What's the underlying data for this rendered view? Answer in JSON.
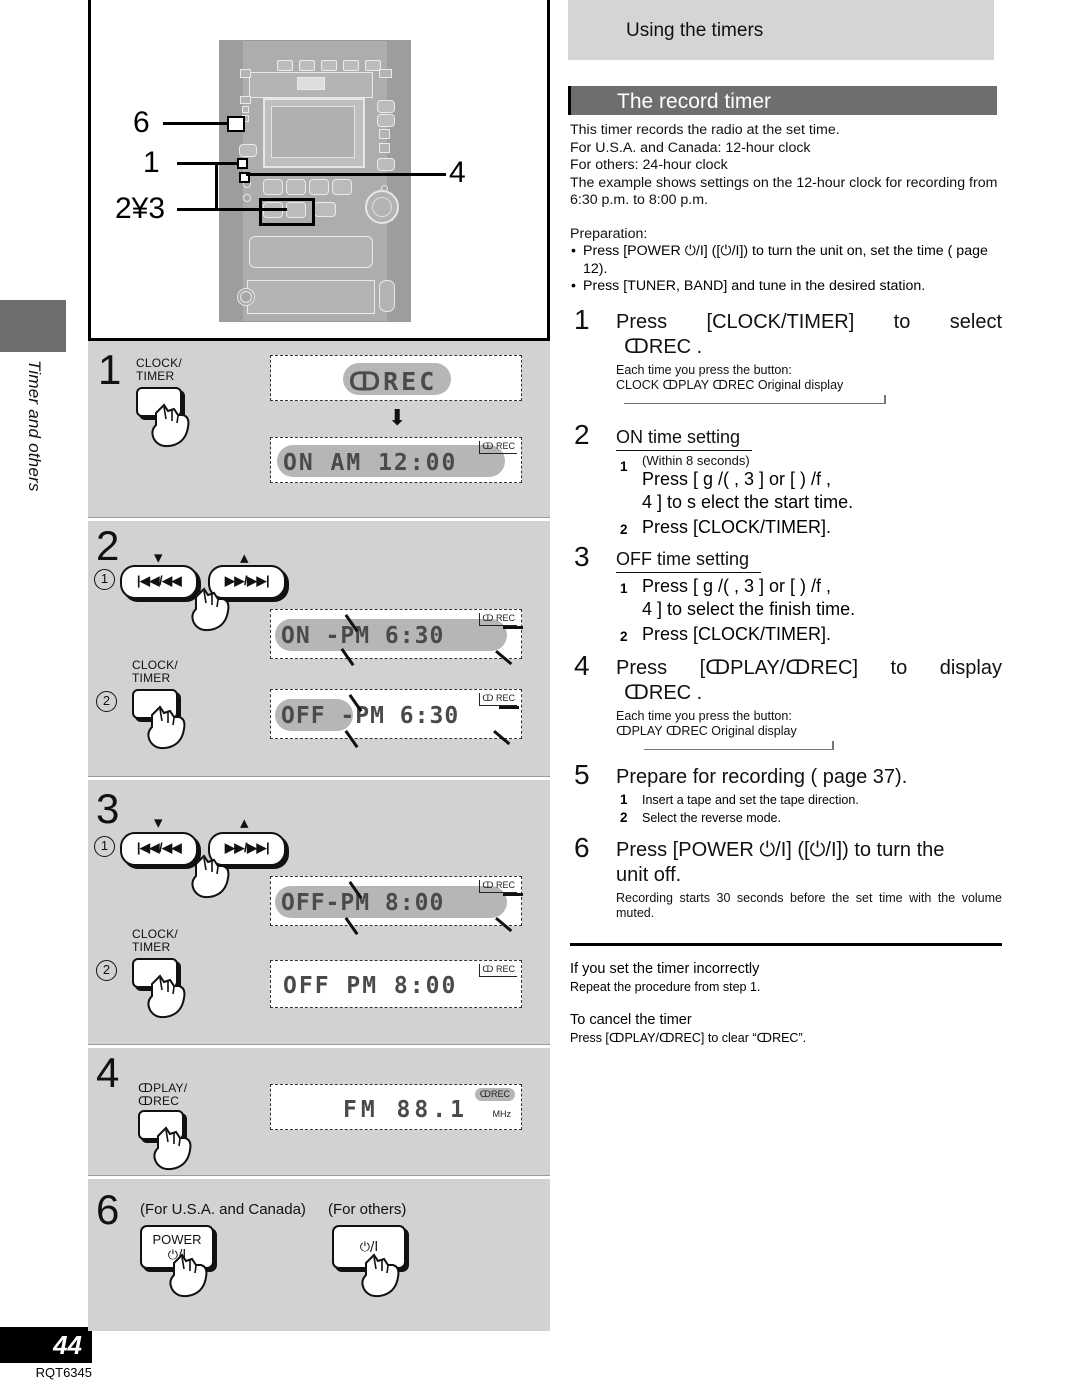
{
  "margin": {
    "vertical_label": "Timer and others",
    "page_number": "44",
    "doc_code": "RQT6345"
  },
  "illustration": {
    "callouts": [
      "6",
      "1",
      "2¥3",
      "4"
    ]
  },
  "left_steps": [
    {
      "num": "1",
      "button_label": "CLOCK/\nTIMER",
      "button_label_line1": "CLOCK/",
      "button_label_line2": "TIMER",
      "displays": [
        {
          "text": "ↀREC",
          "indicator": "",
          "highlight": true
        },
        {
          "text": "ON   AM 12:00",
          "indicator": "ↀ REC",
          "highlight": true
        }
      ]
    },
    {
      "num": "2",
      "sub1": "1",
      "sub2": "2",
      "btn_left": "|◀◀/◀◀",
      "btn_right": "▶▶/▶▶|",
      "button_label_line1": "CLOCK/",
      "button_label_line2": "TIMER",
      "displays": [
        {
          "text": "ON  -PM  6:30",
          "indicator": "ↀ REC",
          "highlight": true
        },
        {
          "text": "OFF -PM  6:30",
          "indicator": "ↀ REC",
          "highlight": "partial"
        }
      ]
    },
    {
      "num": "3",
      "sub1": "1",
      "sub2": "2",
      "btn_left": "|◀◀/◀◀",
      "btn_right": "▶▶/▶▶|",
      "button_label_line1": "CLOCK/",
      "button_label_line2": "TIMER",
      "displays": [
        {
          "text": "OFF-PM  8:00",
          "indicator": "ↀ REC",
          "highlight": true
        },
        {
          "text": "OFF PM  8:00",
          "indicator": "ↀ REC",
          "highlight": false
        }
      ]
    },
    {
      "num": "4",
      "button_label_line1": "ↀPLAY/",
      "button_label_line2": "ↀREC",
      "displays": [
        {
          "text": "FM  88.1",
          "indicator": "ↀREC",
          "unit": "MHz",
          "highlight": false
        }
      ]
    },
    {
      "num": "6",
      "caption_usa": "(For U.S.A. and Canada)",
      "caption_others": "(For others)",
      "power_button_line1": "POWER",
      "power_button_line2": "⏻/I",
      "others_button": "⏻/I"
    }
  ],
  "right": {
    "header_using": "Using the timers",
    "header_record": "The record timer",
    "intro": [
      "This timer records the radio at the set time.",
      "For U.S.A. and Canada:   12-hour clock",
      "For others:   24-hour clock",
      "The example shows settings on the 12-hour clock for recording from 6:30 p.m. to 8:00 p.m."
    ],
    "preparation_label": "Preparation:",
    "preparation": [
      "Press [POWER ⏻/I] ([⏻/I]) to turn the unit on, set the time (   page 12).",
      "Press [TUNER, BAND] and tune in the desired station."
    ],
    "steps": [
      {
        "n": "1",
        "title": "Press  [CLOCK/TIMER]  to  select",
        "title2": "ↀREC .",
        "note": "Each time you press the button:",
        "flow": "CLOCK    ↀPLAY    ↀREC    Original display"
      },
      {
        "n": "2",
        "subtitle": "ON time setting",
        "substeps": [
          {
            "sn": "1",
            "lines": [
              "(Within 8 seconds)",
              "Press [ g     /(      , 3 ] or [ )     /f      ,",
              "4 ] to s elect the start time."
            ]
          },
          {
            "sn": "2",
            "lines": [
              "Press [CLOCK/TIMER]."
            ]
          }
        ]
      },
      {
        "n": "3",
        "subtitle": "OFF time setting",
        "substeps": [
          {
            "sn": "1",
            "lines": [
              "Press [ g     /(      , 3 ] or [ )     /f      ,",
              "4 ] to  select the finish time."
            ]
          },
          {
            "sn": "2",
            "lines": [
              "Press [CLOCK/TIMER]."
            ]
          }
        ]
      },
      {
        "n": "4",
        "title": "Press   [ↀPLAY/ↀREC]   to   display",
        "title2": "ↀREC .",
        "note": "Each time you press the button:",
        "flow": "ↀPLAY    ↀREC    Original display"
      },
      {
        "n": "5",
        "title": "Prepare for recording   (   page 37).",
        "substeps": [
          {
            "sn": "1",
            "lines": [
              "Insert a tape and set the tape direction."
            ]
          },
          {
            "sn": "2",
            "lines": [
              "Select the reverse mode."
            ]
          }
        ]
      },
      {
        "n": "6",
        "title": "Press [POWER ⏻/I] ([⏻/I]) to turn the",
        "title2": "unit off.",
        "note": "Recording starts 30 seconds before the set time with the volume muted."
      }
    ],
    "footer": [
      {
        "head": "If you set the timer incorrectly",
        "body": "Repeat the procedure from step 1."
      },
      {
        "head": "To cancel the timer",
        "body": "Press [ↀPLAY/ↀREC] to clear “ↀREC”."
      }
    ]
  },
  "colors": {
    "panel_gray": "#d2d2d2",
    "header_dark": "#6e6e6e",
    "header_light": "#d5d5d5",
    "lcd_highlight": "#b6b6b6"
  }
}
